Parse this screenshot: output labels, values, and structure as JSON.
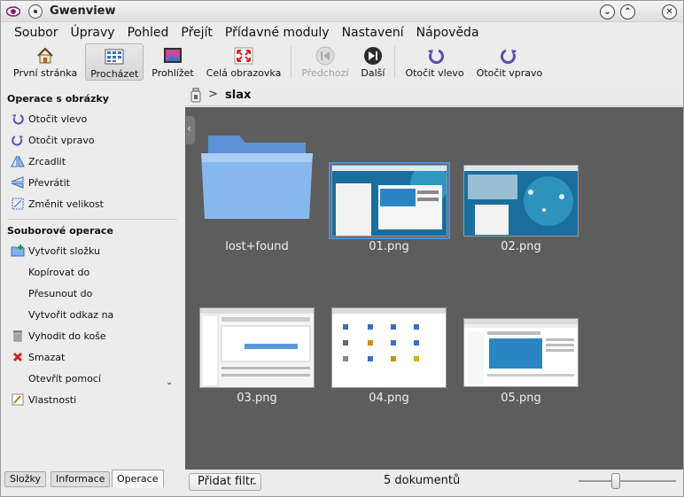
{
  "window": {
    "title": "Gwenview"
  },
  "menu": [
    "Soubor",
    "Úpravy",
    "Pohled",
    "Přejít",
    "Přídavné moduly",
    "Nastavení",
    "Nápověda"
  ],
  "toolbar": {
    "home": "První stránka",
    "browse": "Procházet",
    "view": "Prohlížet",
    "fullscreen": "Celá obrazovka",
    "previous": "Předchozí",
    "next": "Další",
    "rotate_left": "Otočit vlevo",
    "rotate_right": "Otočit vpravo"
  },
  "sidebar": {
    "image_ops_title": "Operace s obrázky",
    "image_ops": [
      "Otočit vlevo",
      "Otočit vpravo",
      "Zrcadlit",
      "Převrátit",
      "Změnit velikost"
    ],
    "file_ops_title": "Souborové operace",
    "file_ops": [
      "Vytvořit složku",
      "Kopírovat do",
      "Přesunout do",
      "Vytvořit odkaz na",
      "Vyhodit do koše",
      "Smazat",
      "Otevřít pomocí",
      "Vlastnosti"
    ],
    "tabs": [
      "Složky",
      "Informace",
      "Operace"
    ]
  },
  "breadcrumb": {
    "current": "slax"
  },
  "items": [
    "lost+found",
    "01.png",
    "02.png",
    "03.png",
    "04.png",
    "05.png"
  ],
  "statusbar": {
    "filter": "Přidat filtr",
    "count": "5 dokumentů"
  },
  "colors": {
    "accent": "#4f8fe0",
    "grid_bg": "#5d5d5d",
    "folder": "#7fb2ea"
  }
}
